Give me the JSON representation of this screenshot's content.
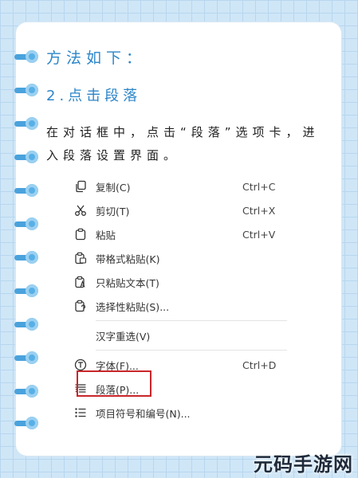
{
  "heading1": "方法如下：",
  "heading2": "2.点击段落",
  "paragraph": "在对话框中，点击“段落”选项卡，进入段落设置界面。",
  "menu": [
    {
      "label": "复制(C)",
      "shortcut": "Ctrl+C",
      "icon": "copy-icon"
    },
    {
      "label": "剪切(T)",
      "shortcut": "Ctrl+X",
      "icon": "scissors-icon"
    },
    {
      "label": "粘贴",
      "shortcut": "Ctrl+V",
      "icon": "clipboard-icon"
    },
    {
      "label": "带格式粘贴(K)",
      "shortcut": "",
      "icon": "paste-format-icon"
    },
    {
      "label": "只粘贴文本(T)",
      "shortcut": "",
      "icon": "paste-text-icon"
    },
    {
      "label": "选择性粘贴(S)...",
      "shortcut": "",
      "icon": "paste-special-icon"
    },
    {
      "label": "汉字重选(V)",
      "shortcut": "",
      "icon": ""
    },
    {
      "label": "字体(F)...",
      "shortcut": "Ctrl+D",
      "icon": "font-icon"
    },
    {
      "label": "段落(P)...",
      "shortcut": "",
      "icon": "paragraph-icon"
    },
    {
      "label": "项目符号和编号(N)...",
      "shortcut": "",
      "icon": "list-icon"
    }
  ],
  "watermark": "元码手游网",
  "colors": {
    "accent": "#2c86c9",
    "highlight": "#c9262a",
    "background": "#cfe6f7"
  }
}
